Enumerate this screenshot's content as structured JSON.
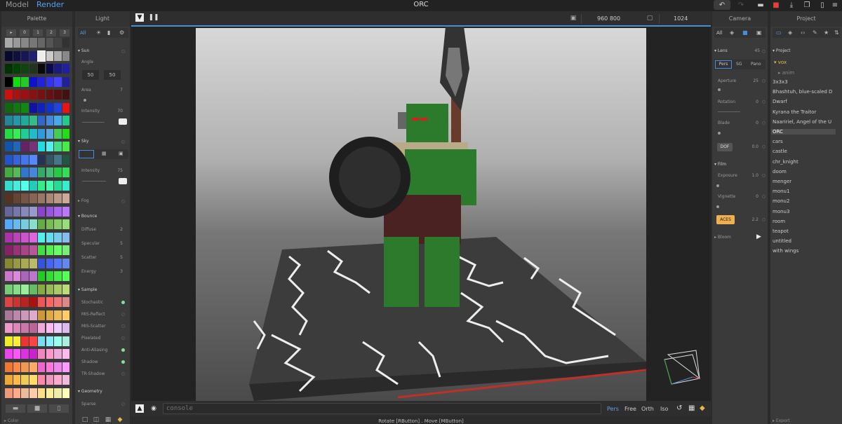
{
  "topbar": {
    "mode_model": "Model",
    "mode_render": "Render",
    "title": "ORC"
  },
  "palette": {
    "title": "Palette",
    "tabs": [
      "▸",
      "0",
      "1",
      "2",
      "3"
    ],
    "footer": "Color"
  },
  "light": {
    "title": "Light",
    "filter_all": "All",
    "sun": {
      "label": "Sun",
      "angle_label": "Angle",
      "angle_a": "50",
      "angle_b": "50",
      "area_label": "Area",
      "area_value": "7",
      "intensity_label": "Intensity",
      "intensity_value": "70"
    },
    "sky": {
      "label": "Sky",
      "intensity_label": "Intensity",
      "intensity_value": "75"
    },
    "fog": {
      "label": "Fog"
    },
    "bounce": {
      "label": "Bounce",
      "diffuse_label": "Diffuse",
      "diffuse_value": "2",
      "specular_label": "Specular",
      "specular_value": "5",
      "scatter_label": "Scatter",
      "scatter_value": "5",
      "energy_label": "Energy",
      "energy_value": "3"
    },
    "sample": {
      "label": "Sample",
      "items": [
        "Stochastic",
        "MIS-Reflect",
        "MIS-Scatter",
        "Pixelated",
        "Anti-Aliasing",
        "Shadow",
        "TR-Shadow"
      ]
    },
    "geometry": {
      "label": "Geometry",
      "sparse_label": "Sparse"
    }
  },
  "viewport": {
    "resolution": "960  800",
    "samples": "1024",
    "console_placeholder": "console",
    "proj_modes": [
      "Pers",
      "Free",
      "Orth",
      "Iso"
    ],
    "status": "Rotate [RButton] . Move [MButton]"
  },
  "camera": {
    "title": "Camera",
    "filter_all": "All",
    "lens": {
      "label": "Lens",
      "value": "45",
      "modes": [
        "Pers",
        "SG",
        "Pano"
      ],
      "aperture_label": "Aperture",
      "aperture_value": "25",
      "rotation_label": "Rotation",
      "rotation_value": "0",
      "blade_label": "Blade",
      "blade_value": "0",
      "dof_label": "DOF",
      "dof_value": "0.0"
    },
    "film": {
      "label": "Film",
      "exposure_label": "Exposure",
      "exposure_value": "1.0",
      "vignette_label": "Vignette",
      "vignette_value": "0",
      "aces_label": "ACES",
      "aces_value": "2.2"
    },
    "bloom": {
      "label": "Bloom"
    }
  },
  "project": {
    "title": "Project",
    "root_label": "Project",
    "folder_vox": "vox",
    "folder_anim": "anim",
    "items": [
      "3x3x3",
      "Bhashtuh, blue-scaled D",
      "Dwarf",
      "Kyrana the Traitor",
      "Naaririel, Angel of the U",
      "ORC",
      "cars",
      "castle",
      "chr_knight",
      "doom",
      "menger",
      "monu1",
      "monu2",
      "monu3",
      "room",
      "teapot",
      "untitled",
      "with wings"
    ],
    "selected": "ORC",
    "footer": "Export"
  },
  "colors": {
    "accent": "#4a8cd9",
    "render_mode": "#5aa0ee",
    "vox_folder": "#e8b84a",
    "aces_button": "#f0b050",
    "save_icon": "#e04040"
  }
}
